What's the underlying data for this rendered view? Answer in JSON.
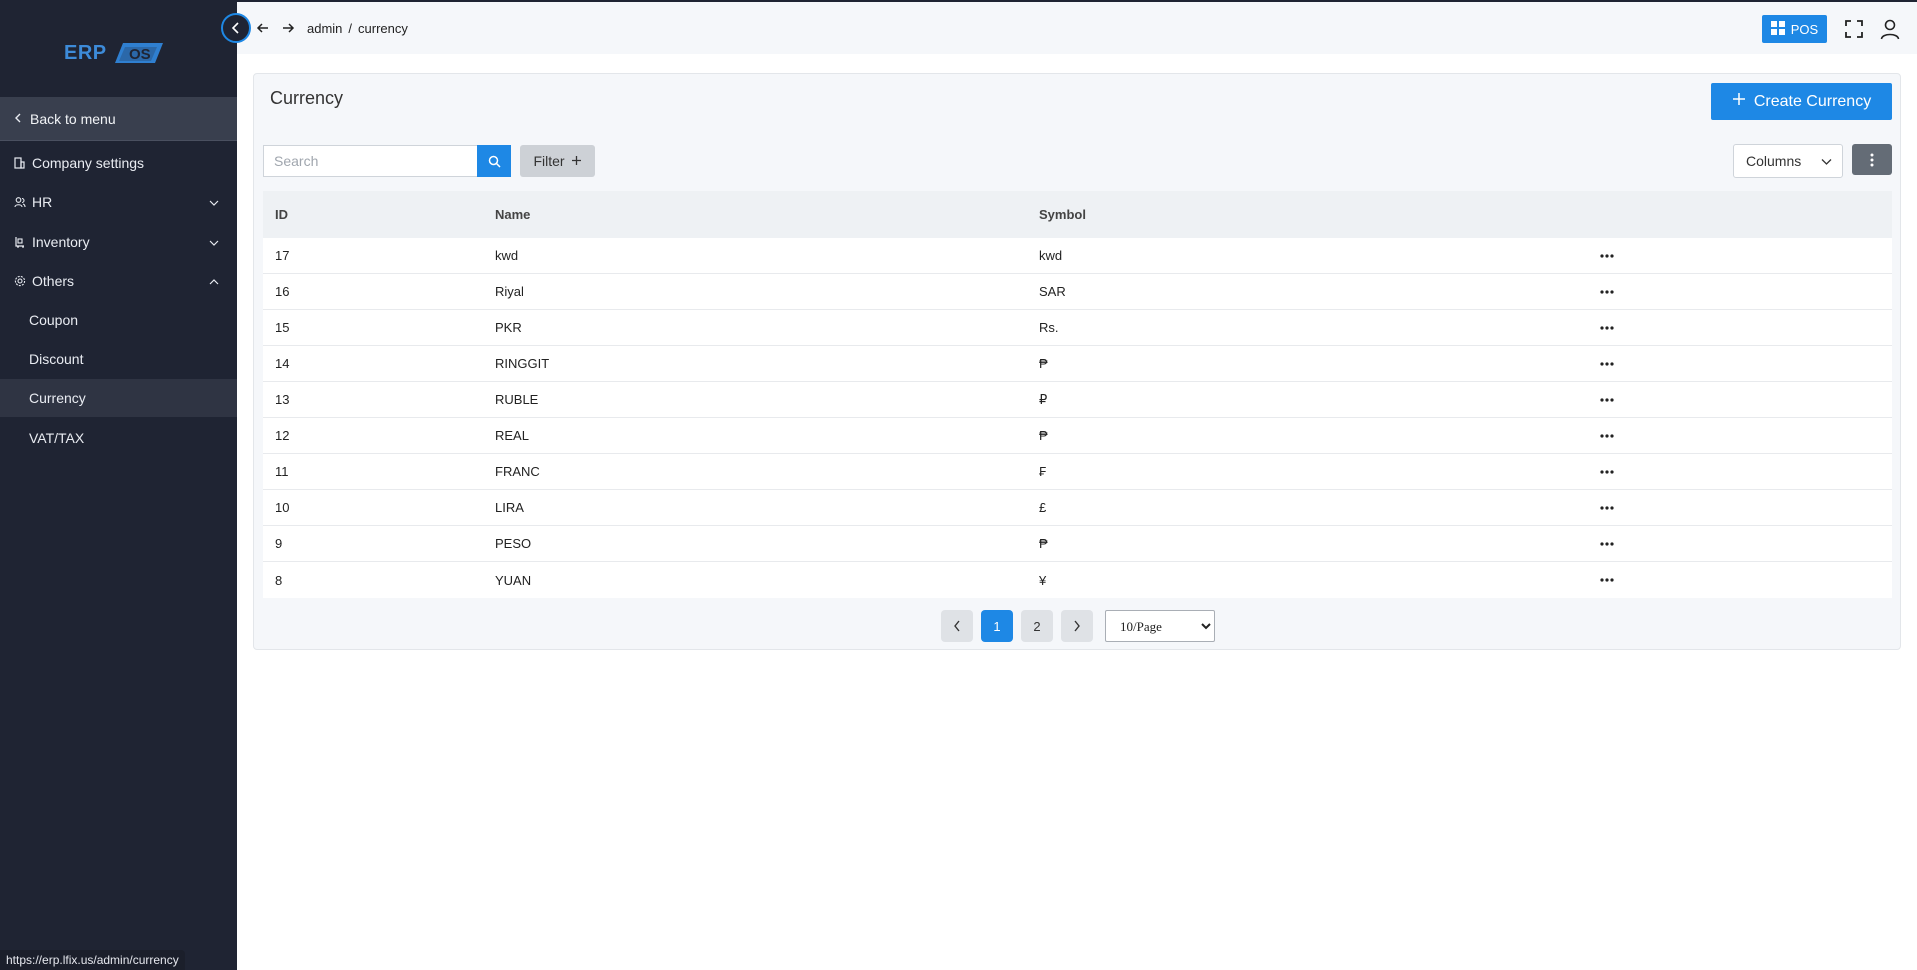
{
  "sidebar": {
    "logo_text": "ERP",
    "logo_suffix": "OS",
    "back_label": "Back to menu",
    "items": [
      {
        "label": "Company settings"
      },
      {
        "label": "HR"
      },
      {
        "label": "Inventory"
      },
      {
        "label": "Others"
      }
    ],
    "sub_items": [
      {
        "label": "Coupon"
      },
      {
        "label": "Discount"
      },
      {
        "label": "Currency"
      },
      {
        "label": "VAT/TAX"
      }
    ],
    "active_sub": "Currency"
  },
  "topbar": {
    "breadcrumb_root": "admin",
    "breadcrumb_sep": "/",
    "breadcrumb_page": "currency",
    "pos_label": "POS"
  },
  "page": {
    "title": "Currency",
    "create_label": "Create Currency",
    "search_placeholder": "Search",
    "filter_label": "Filter",
    "columns_label": "Columns"
  },
  "table": {
    "headers": {
      "id": "ID",
      "name": "Name",
      "symbol": "Symbol"
    },
    "rows": [
      {
        "id": "17",
        "name": "kwd",
        "symbol": "kwd"
      },
      {
        "id": "16",
        "name": "Riyal",
        "symbol": "SAR"
      },
      {
        "id": "15",
        "name": "PKR",
        "symbol": "Rs."
      },
      {
        "id": "14",
        "name": "RINGGIT",
        "symbol": "₱"
      },
      {
        "id": "13",
        "name": "RUBLE",
        "symbol": "₽"
      },
      {
        "id": "12",
        "name": "REAL",
        "symbol": "₱"
      },
      {
        "id": "11",
        "name": "FRANC",
        "symbol": "₣"
      },
      {
        "id": "10",
        "name": "LIRA",
        "symbol": "£"
      },
      {
        "id": "9",
        "name": "PESO",
        "symbol": "₱"
      },
      {
        "id": "8",
        "name": "YUAN",
        "symbol": "¥"
      }
    ]
  },
  "pagination": {
    "pages": [
      "1",
      "2"
    ],
    "current": "1",
    "per_page": "10/Page"
  },
  "status_url": "https://erp.lfix.us/admin/currency",
  "colors": {
    "sidebar_bg": "#1f2433",
    "accent": "#1e88e5"
  }
}
